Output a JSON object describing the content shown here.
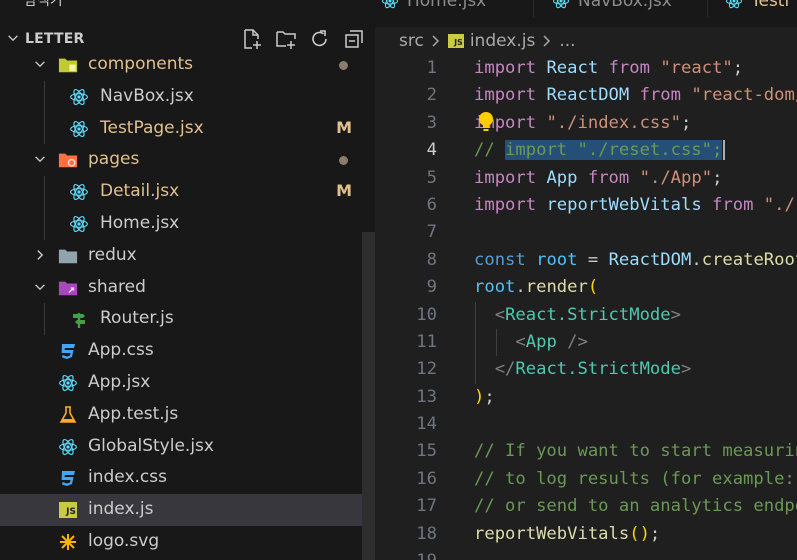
{
  "sidebar": {
    "title": "탐색기",
    "root_folder": "LETTER",
    "items": [
      {
        "label": "components",
        "type": "folder",
        "depth": 1,
        "expanded": true,
        "icon": "folder-components-icon",
        "modified_dot": true
      },
      {
        "label": "NavBox.jsx",
        "type": "file",
        "depth": 2,
        "icon": "react-icon"
      },
      {
        "label": "TestPage.jsx",
        "type": "file",
        "depth": 2,
        "icon": "react-icon",
        "badge": "M"
      },
      {
        "label": "pages",
        "type": "folder",
        "depth": 1,
        "expanded": true,
        "icon": "folder-pages-icon",
        "modified_dot": true
      },
      {
        "label": "Detail.jsx",
        "type": "file",
        "depth": 2,
        "icon": "react-icon",
        "badge": "M"
      },
      {
        "label": "Home.jsx",
        "type": "file",
        "depth": 2,
        "icon": "react-icon"
      },
      {
        "label": "redux",
        "type": "folder",
        "depth": 1,
        "expanded": false,
        "icon": "folder-icon"
      },
      {
        "label": "shared",
        "type": "folder",
        "depth": 1,
        "expanded": true,
        "icon": "folder-shared-icon"
      },
      {
        "label": "Router.js",
        "type": "file",
        "depth": 2,
        "icon": "router-icon"
      },
      {
        "label": "App.css",
        "type": "file",
        "depth": 1,
        "icon": "css-icon"
      },
      {
        "label": "App.jsx",
        "type": "file",
        "depth": 1,
        "icon": "react-icon"
      },
      {
        "label": "App.test.js",
        "type": "file",
        "depth": 1,
        "icon": "test-flask-icon"
      },
      {
        "label": "GlobalStyle.jsx",
        "type": "file",
        "depth": 1,
        "icon": "react-icon"
      },
      {
        "label": "index.css",
        "type": "file",
        "depth": 1,
        "icon": "css-icon"
      },
      {
        "label": "index.js",
        "type": "file",
        "depth": 1,
        "icon": "js-icon",
        "selected": true
      },
      {
        "label": "logo.svg",
        "type": "file",
        "depth": 1,
        "icon": "svg-icon"
      }
    ]
  },
  "tabs": [
    {
      "label": "Home.jsx",
      "icon": "react-icon"
    },
    {
      "label": "NavBox.jsx",
      "icon": "react-icon"
    },
    {
      "label": "Testi",
      "icon": "react-icon",
      "modified": true
    }
  ],
  "breadcrumb": {
    "folder": "src",
    "file": "index.js",
    "more": "..."
  },
  "editor": {
    "active_line": 4,
    "lines": [
      {
        "n": "1",
        "html": "<span class='kw'>import</span> <span class='v'>React</span> <span class='kw'>from</span> <span class='s'>\"react\"</span>;"
      },
      {
        "n": "2",
        "html": "<span class='kw'>import</span> <span class='v'>ReactDOM</span> <span class='kw'>from</span> <span class='s'>\"react-dom/client\"</span>;"
      },
      {
        "n": "3",
        "html": "<span class='kw'>import</span> <span class='s'>\"./index.css\"</span>;"
      },
      {
        "n": "4",
        "html": "<span class='cm'>// <span class='sel'>import \"./reset.css\";</span></span>"
      },
      {
        "n": "5",
        "html": "<span class='kw'>import</span> <span class='v'>App</span> <span class='kw'>from</span> <span class='s'>\"./App\"</span>;"
      },
      {
        "n": "6",
        "html": "<span class='kw'>import</span> <span class='v'>reportWebVitals</span> <span class='kw'>from</span> <span class='s'>\"./reportWebVitals\"</span>;"
      },
      {
        "n": "7",
        "html": ""
      },
      {
        "n": "8",
        "html": "<span class='k'>const</span> <span class='c'>root</span> = <span class='v'>ReactDOM</span>.<span class='f'>createRoot</span>(<span class='v'>document</span>);"
      },
      {
        "n": "9",
        "html": "<span class='c'>root</span>.<span class='f'>render</span><span class='p1'>(</span>"
      },
      {
        "n": "10",
        "html": "  <span class='tg'>&lt;</span><span class='tn'>React.StrictMode</span><span class='tg'>&gt;</span>"
      },
      {
        "n": "11",
        "html": "    <span class='tg'>&lt;</span><span class='tn'>App</span> <span class='tg'>/&gt;</span>"
      },
      {
        "n": "12",
        "html": "  <span class='tg'>&lt;/</span><span class='tn'>React.StrictMode</span><span class='tg'>&gt;</span>"
      },
      {
        "n": "13",
        "html": "<span class='p1'>)</span>;"
      },
      {
        "n": "14",
        "html": ""
      },
      {
        "n": "15",
        "html": "<span class='cm'>// If you want to start measuring performance in your app</span>"
      },
      {
        "n": "16",
        "html": "<span class='cm'>// to log results (for example: reportWebVitals(console.log))</span>"
      },
      {
        "n": "17",
        "html": "<span class='cm'>// or send to an analytics endpoint. Learn more</span>"
      },
      {
        "n": "18",
        "html": "<span class='f'>reportWebVitals</span><span class='p1'>()</span>;"
      },
      {
        "n": "19",
        "html": ""
      }
    ]
  },
  "colors": {
    "sidebar_bg": "#181818",
    "editor_bg": "#1f1f1f",
    "selection": "#264f78",
    "modified": "#e2c08d"
  }
}
